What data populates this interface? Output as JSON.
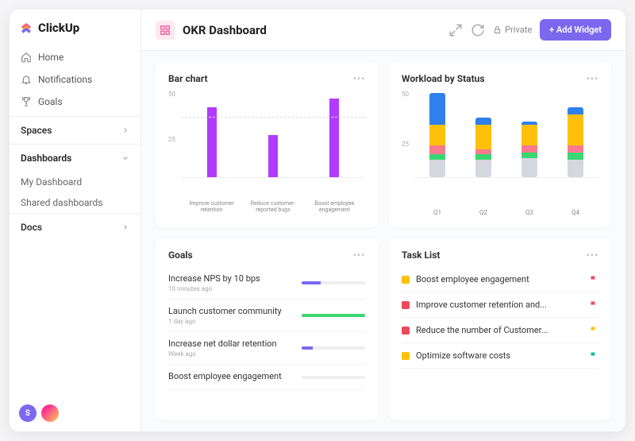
{
  "brand": "ClickUp",
  "sidebar": {
    "nav": [
      {
        "label": "Home",
        "icon": "home"
      },
      {
        "label": "Notifications",
        "icon": "bell"
      },
      {
        "label": "Goals",
        "icon": "trophy"
      }
    ],
    "sections": [
      {
        "label": "Spaces",
        "expanded": false,
        "items": []
      },
      {
        "label": "Dashboards",
        "expanded": true,
        "items": [
          {
            "label": "My Dashboard"
          },
          {
            "label": "Shared dashboards"
          }
        ]
      },
      {
        "label": "Docs",
        "expanded": false,
        "items": []
      }
    ],
    "avatar_initial": "S"
  },
  "header": {
    "title": "OKR Dashboard",
    "private_label": "Private",
    "add_widget_label": "+ Add Widget"
  },
  "cards": {
    "bar": {
      "title": "Bar chart",
      "ymax_label": "50",
      "ymid_label": "25"
    },
    "workload": {
      "title": "Workload by Status",
      "ymax_label": "50",
      "ymid_label": "25"
    },
    "goals": {
      "title": "Goals",
      "items": [
        {
          "name": "Increase NPS by 10 bps",
          "time": "10 minutes ago",
          "pct": 30,
          "color": "#7b68ee"
        },
        {
          "name": "Launch customer community",
          "time": "1 day ago",
          "pct": 100,
          "color": "#3bd671"
        },
        {
          "name": "Increase net dollar retention",
          "time": "Week ago",
          "pct": 18,
          "color": "#7b68ee"
        },
        {
          "name": "Boost employee engagement",
          "time": "",
          "pct": 0,
          "color": "#ccc"
        }
      ]
    },
    "tasks": {
      "title": "Task List",
      "items": [
        {
          "name": "Boost employee engagement",
          "sq": "#ffc107",
          "flag": "#ec4a5f"
        },
        {
          "name": "Improve customer retention and...",
          "sq": "#ec4a5f",
          "flag": "#ec4a5f"
        },
        {
          "name": "Reduce the number of Customer...",
          "sq": "#ec4a5f",
          "flag": "#ffc107"
        },
        {
          "name": "Optimize software costs",
          "sq": "#ffc107",
          "flag": "#1abc9c"
        }
      ]
    }
  },
  "chart_data": [
    {
      "id": "bar_chart",
      "type": "bar",
      "title": "Bar chart",
      "ylim": [
        0,
        50
      ],
      "categories": [
        "Improve customer retention",
        "Reduce customer-reported bugs",
        "Boost employee engagement"
      ],
      "values": [
        40,
        24,
        45
      ],
      "color": "#b13cff"
    },
    {
      "id": "workload_by_status",
      "type": "stacked-bar",
      "title": "Workload by Status",
      "ylim": [
        0,
        50
      ],
      "categories": [
        "Q1",
        "Q2",
        "Q3",
        "Q4"
      ],
      "series": [
        {
          "name": "grey",
          "color": "#d5d7de",
          "values": [
            10,
            10,
            11,
            10
          ]
        },
        {
          "name": "green",
          "color": "#3bd671",
          "values": [
            3,
            3,
            3,
            4
          ]
        },
        {
          "name": "pink",
          "color": "#f77a8f",
          "values": [
            5,
            3,
            4,
            4
          ]
        },
        {
          "name": "yellow",
          "color": "#ffc107",
          "values": [
            12,
            14,
            12,
            18
          ]
        },
        {
          "name": "blue",
          "color": "#2f80ed",
          "values": [
            18,
            4,
            2,
            4
          ]
        }
      ]
    }
  ],
  "colors": {
    "accent": "#7b68ee",
    "purple_bar": "#b13cff"
  }
}
